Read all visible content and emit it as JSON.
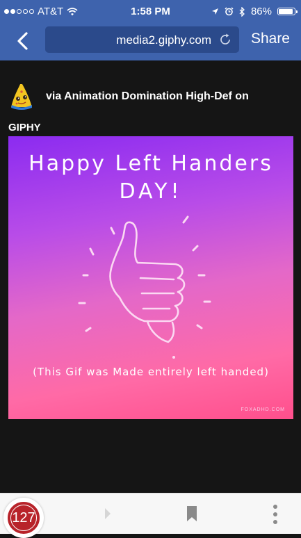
{
  "status_bar": {
    "carrier": "AT&T",
    "time": "1:58 PM",
    "battery_percent": "86%"
  },
  "browser": {
    "url": "media2.giphy.com",
    "share_label": "Share"
  },
  "post": {
    "via_text": "via Animation Domination High-Def on",
    "source_label": "GIPHY"
  },
  "gif": {
    "line1": "Happy Left Handers",
    "line2": "DAY!",
    "caption": "(This Gif was Made entirely left handed)",
    "credit": "FOXADHD.COM"
  },
  "toolbar": {
    "badge_count": "127"
  },
  "colors": {
    "nav_blue": "#3e63ad",
    "url_bg": "#2b4a8b",
    "badge_red": "#b8232a"
  }
}
